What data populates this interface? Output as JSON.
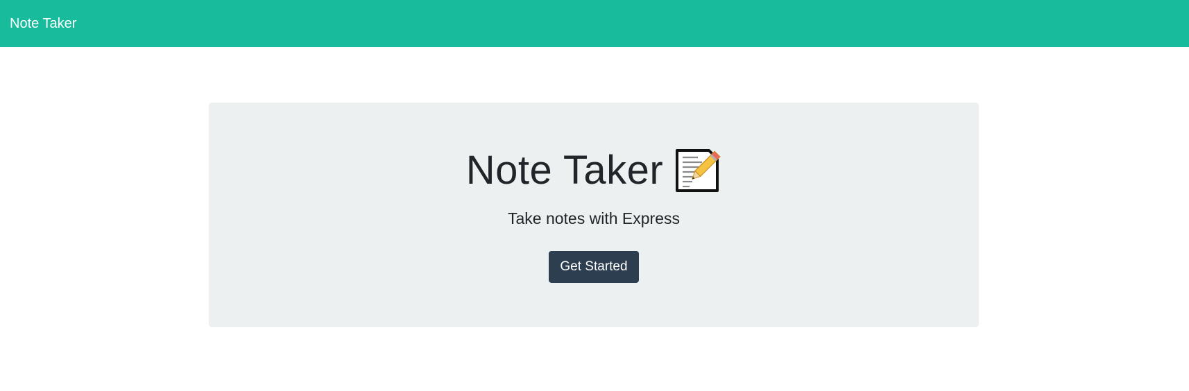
{
  "navbar": {
    "brand": "Note Taker",
    "background_color": "#18bc9c"
  },
  "hero": {
    "title": "Note Taker",
    "icon": "memo-icon",
    "subtitle": "Take notes with Express",
    "button_label": "Get Started",
    "button_color": "#2c3e50",
    "panel_color": "#ecf0f1"
  }
}
